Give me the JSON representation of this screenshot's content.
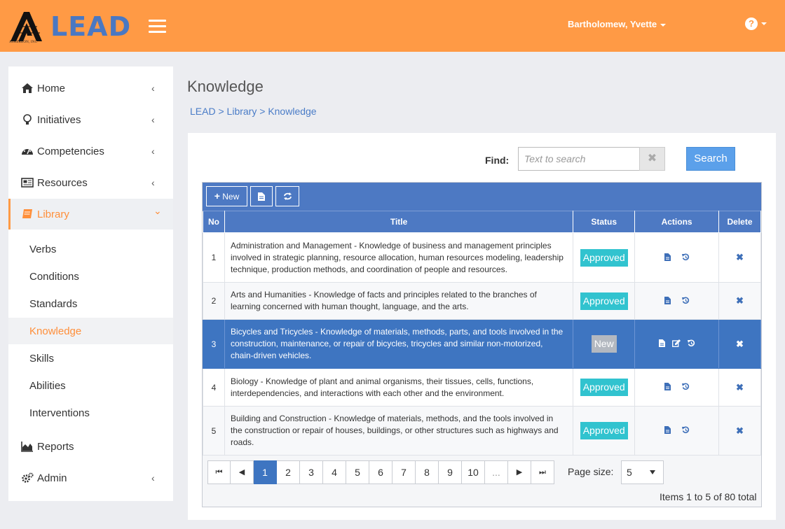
{
  "header": {
    "logo_text": "LEAD",
    "logo_subtext": "AIMEREON, INC",
    "user_name": "Bartholomew, Yvette",
    "help_symbol": "?"
  },
  "sidebar": {
    "items": [
      {
        "label": "Home",
        "icon": "home-icon"
      },
      {
        "label": "Initiatives",
        "icon": "lightbulb-icon"
      },
      {
        "label": "Competencies",
        "icon": "dashboard-icon"
      },
      {
        "label": "Resources",
        "icon": "newspaper-icon"
      },
      {
        "label": "Library",
        "icon": "book-icon"
      },
      {
        "label": "Reports",
        "icon": "area-chart-icon"
      },
      {
        "label": "Admin",
        "icon": "cogs-icon"
      }
    ],
    "library_subitems": [
      "Verbs",
      "Conditions",
      "Standards",
      "Knowledge",
      "Skills",
      "Abilities",
      "Interventions"
    ],
    "chevron_collapsed": "‹",
    "chevron_expanded": "⌄"
  },
  "page": {
    "title": "Knowledge",
    "breadcrumb": [
      "LEAD",
      "Library",
      "Knowledge"
    ],
    "breadcrumb_sep": ">"
  },
  "search": {
    "label": "Find:",
    "placeholder": "Text to search",
    "value": "",
    "clear_symbol": "✖",
    "button_label": "Search"
  },
  "toolbar": {
    "new_label": "New"
  },
  "table": {
    "columns": [
      "No",
      "Title",
      "Status",
      "Actions",
      "Delete"
    ],
    "rows": [
      {
        "no": "1",
        "title": "Administration and Management - Knowledge of business and management principles involved in strategic planning, resource allocation, human resources modeling, leadership technique, production methods, and coordination of people and resources.",
        "status": "Approved"
      },
      {
        "no": "2",
        "title": "Arts and Humanities - Knowledge of facts and principles related to the branches of learning concerned with human thought, language, and the arts.",
        "status": "Approved"
      },
      {
        "no": "3",
        "title": "Bicycles and Tricycles - Knowledge of materials, methods, parts, and tools involved in the construction, maintenance, or repair of bicycles, tricycles and similar non-motorized, chain-driven vehicles.",
        "status": "New"
      },
      {
        "no": "4",
        "title": "Biology - Knowledge of plant and animal organisms, their tissues, cells, functions, interdependencies, and interactions with each other and the environment.",
        "status": "Approved"
      },
      {
        "no": "5",
        "title": "Building and Construction - Knowledge of materials, methods, and the tools involved in the construction or repair of houses, buildings, or other structures such as highways and roads.",
        "status": "Approved"
      }
    ]
  },
  "pager": {
    "first": "⏮",
    "prev": "◀",
    "next": "▶",
    "last": "⏭",
    "pages": [
      "1",
      "2",
      "3",
      "4",
      "5",
      "6",
      "7",
      "8",
      "9",
      "10",
      "..."
    ],
    "current_page": "1",
    "page_size_label": "Page size:",
    "page_size": "5",
    "items_info": "Items 1 to 5 of 80 total"
  },
  "colors": {
    "header": "#ff9a45",
    "brand_blue": "#4a78c2",
    "grid_header": "#4d79c3",
    "selected_row": "#3e75c1",
    "approved": "#31c3cf",
    "new": "#b3b8c0",
    "search_button": "#5ba0ea"
  }
}
